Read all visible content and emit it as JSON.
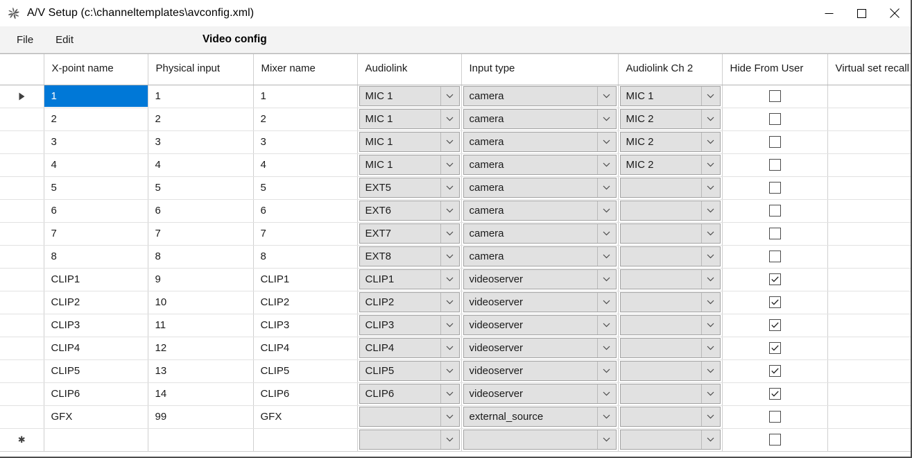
{
  "window": {
    "title": "A/V Setup (c:\\channeltemplates\\avconfig.xml)",
    "icon": "pinwheel-icon",
    "controls": {
      "minimize": "minimize-icon",
      "maximize": "maximize-icon",
      "close": "close-icon"
    }
  },
  "menubar": {
    "items": [
      {
        "label": "File"
      },
      {
        "label": "Edit"
      }
    ],
    "heading": "Video config"
  },
  "grid": {
    "columns": [
      {
        "key": "rowhdr",
        "label": ""
      },
      {
        "key": "xpoint",
        "label": "X-point name"
      },
      {
        "key": "physical",
        "label": "Physical input"
      },
      {
        "key": "mixer",
        "label": "Mixer name"
      },
      {
        "key": "audiolink",
        "label": "Audiolink"
      },
      {
        "key": "inputtype",
        "label": "Input type"
      },
      {
        "key": "audiolink2",
        "label": "Audiolink Ch 2"
      },
      {
        "key": "hide",
        "label": "Hide From User"
      },
      {
        "key": "virtualset",
        "label": "Virtual set recall"
      }
    ],
    "selection": {
      "row": 0,
      "column": "xpoint",
      "color": "#0078d7"
    },
    "markers": {
      "current_row": "▶",
      "new_row": "✱"
    },
    "rows": [
      {
        "marker": "current",
        "xpoint": "1",
        "physical": "1",
        "mixer": "1",
        "audiolink": "MIC 1",
        "inputtype": "camera",
        "audiolink2": "MIC 1",
        "hide": false,
        "virtualset": ""
      },
      {
        "marker": "",
        "xpoint": "2",
        "physical": "2",
        "mixer": "2",
        "audiolink": "MIC 1",
        "inputtype": "camera",
        "audiolink2": "MIC 2",
        "hide": false,
        "virtualset": ""
      },
      {
        "marker": "",
        "xpoint": "3",
        "physical": "3",
        "mixer": "3",
        "audiolink": "MIC 1",
        "inputtype": "camera",
        "audiolink2": "MIC 2",
        "hide": false,
        "virtualset": ""
      },
      {
        "marker": "",
        "xpoint": "4",
        "physical": "4",
        "mixer": "4",
        "audiolink": "MIC 1",
        "inputtype": "camera",
        "audiolink2": "MIC 2",
        "hide": false,
        "virtualset": ""
      },
      {
        "marker": "",
        "xpoint": "5",
        "physical": "5",
        "mixer": "5",
        "audiolink": "EXT5",
        "inputtype": "camera",
        "audiolink2": "",
        "hide": false,
        "virtualset": ""
      },
      {
        "marker": "",
        "xpoint": "6",
        "physical": "6",
        "mixer": "6",
        "audiolink": "EXT6",
        "inputtype": "camera",
        "audiolink2": "",
        "hide": false,
        "virtualset": ""
      },
      {
        "marker": "",
        "xpoint": "7",
        "physical": "7",
        "mixer": "7",
        "audiolink": "EXT7",
        "inputtype": "camera",
        "audiolink2": "",
        "hide": false,
        "virtualset": ""
      },
      {
        "marker": "",
        "xpoint": "8",
        "physical": "8",
        "mixer": "8",
        "audiolink": "EXT8",
        "inputtype": "camera",
        "audiolink2": "",
        "hide": false,
        "virtualset": ""
      },
      {
        "marker": "",
        "xpoint": "CLIP1",
        "physical": "9",
        "mixer": "CLIP1",
        "audiolink": "CLIP1",
        "inputtype": "videoserver",
        "audiolink2": "",
        "hide": true,
        "virtualset": ""
      },
      {
        "marker": "",
        "xpoint": "CLIP2",
        "physical": "10",
        "mixer": "CLIP2",
        "audiolink": "CLIP2",
        "inputtype": "videoserver",
        "audiolink2": "",
        "hide": true,
        "virtualset": ""
      },
      {
        "marker": "",
        "xpoint": "CLIP3",
        "physical": "11",
        "mixer": "CLIP3",
        "audiolink": "CLIP3",
        "inputtype": "videoserver",
        "audiolink2": "",
        "hide": true,
        "virtualset": ""
      },
      {
        "marker": "",
        "xpoint": "CLIP4",
        "physical": "12",
        "mixer": "CLIP4",
        "audiolink": "CLIP4",
        "inputtype": "videoserver",
        "audiolink2": "",
        "hide": true,
        "virtualset": ""
      },
      {
        "marker": "",
        "xpoint": "CLIP5",
        "physical": "13",
        "mixer": "CLIP5",
        "audiolink": "CLIP5",
        "inputtype": "videoserver",
        "audiolink2": "",
        "hide": true,
        "virtualset": ""
      },
      {
        "marker": "",
        "xpoint": "CLIP6",
        "physical": "14",
        "mixer": "CLIP6",
        "audiolink": "CLIP6",
        "inputtype": "videoserver",
        "audiolink2": "",
        "hide": true,
        "virtualset": ""
      },
      {
        "marker": "",
        "xpoint": "GFX",
        "physical": "99",
        "mixer": "GFX",
        "audiolink": "",
        "inputtype": "external_source",
        "audiolink2": "",
        "hide": false,
        "virtualset": ""
      },
      {
        "marker": "new",
        "xpoint": "",
        "physical": "",
        "mixer": "",
        "audiolink": "",
        "inputtype": "",
        "audiolink2": "",
        "hide": false,
        "virtualset": ""
      }
    ]
  }
}
